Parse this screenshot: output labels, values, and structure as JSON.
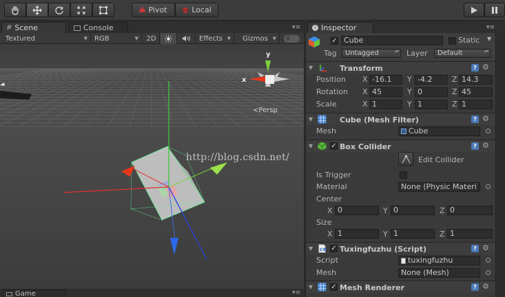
{
  "toolbar": {
    "tools": [
      "hand-tool",
      "move-tool",
      "rotate-tool",
      "scale-tool",
      "rect-tool"
    ],
    "pivot_label": "Pivot",
    "local_label": "Local"
  },
  "scene_panel": {
    "tabs": [
      {
        "label": "Scene",
        "active": true,
        "icon": "scene-grid-icon"
      },
      {
        "label": "Console",
        "active": false,
        "icon": "console-icon"
      }
    ],
    "toolbar": {
      "shading_mode": "Textured",
      "render_mode": "RGB",
      "mode_2d": "2D",
      "effects": "Effects",
      "gizmos": "Gizmos"
    },
    "gizmo": {
      "x_label": "x",
      "y_label": "y",
      "projection_label": "Persp"
    },
    "watermark": "http://blog.csdn.net/"
  },
  "bottom_panel": {
    "tab_label": "Game"
  },
  "inspector": {
    "tab_label": "Inspector",
    "object": {
      "name": "Cube",
      "active": true,
      "static_label": "Static",
      "static_checked": false,
      "tag_label": "Tag",
      "tag_value": "Untagged",
      "layer_label": "Layer",
      "layer_value": "Default"
    },
    "transform": {
      "title": "Transform",
      "position_label": "Position",
      "rotation_label": "Rotation",
      "scale_label": "Scale",
      "position": {
        "x": "-16.1",
        "y": "-4.2",
        "z": "14.3"
      },
      "rotation": {
        "x": "45",
        "y": "0",
        "z": "45"
      },
      "scale": {
        "x": "1",
        "y": "1",
        "z": "1"
      }
    },
    "mesh_filter": {
      "title": "Cube (Mesh Filter)",
      "mesh_label": "Mesh",
      "mesh_value": "Cube"
    },
    "box_collider": {
      "title": "Box Collider",
      "enabled": true,
      "edit_label": "Edit Collider",
      "is_trigger_label": "Is Trigger",
      "is_trigger": false,
      "material_label": "Material",
      "material_value": "None (Physic Materi",
      "center_label": "Center",
      "center": {
        "x": "0",
        "y": "0",
        "z": "0"
      },
      "size_label": "Size",
      "size": {
        "x": "1",
        "y": "1",
        "z": "1"
      }
    },
    "script": {
      "title": "Tuxingfuzhu (Script)",
      "enabled": true,
      "script_label": "Script",
      "script_value": "tuxingfuzhu",
      "mesh_label": "Mesh",
      "mesh_value": "None (Mesh)"
    },
    "mesh_renderer": {
      "title": "Mesh Renderer",
      "enabled": true
    }
  },
  "labels": {
    "x": "X",
    "y": "Y",
    "z": "Z"
  },
  "colors": {
    "axis_x": "#e8361b",
    "axis_y": "#7ad23a",
    "axis_z": "#3a6ee8",
    "selection": "#5cf08c"
  }
}
